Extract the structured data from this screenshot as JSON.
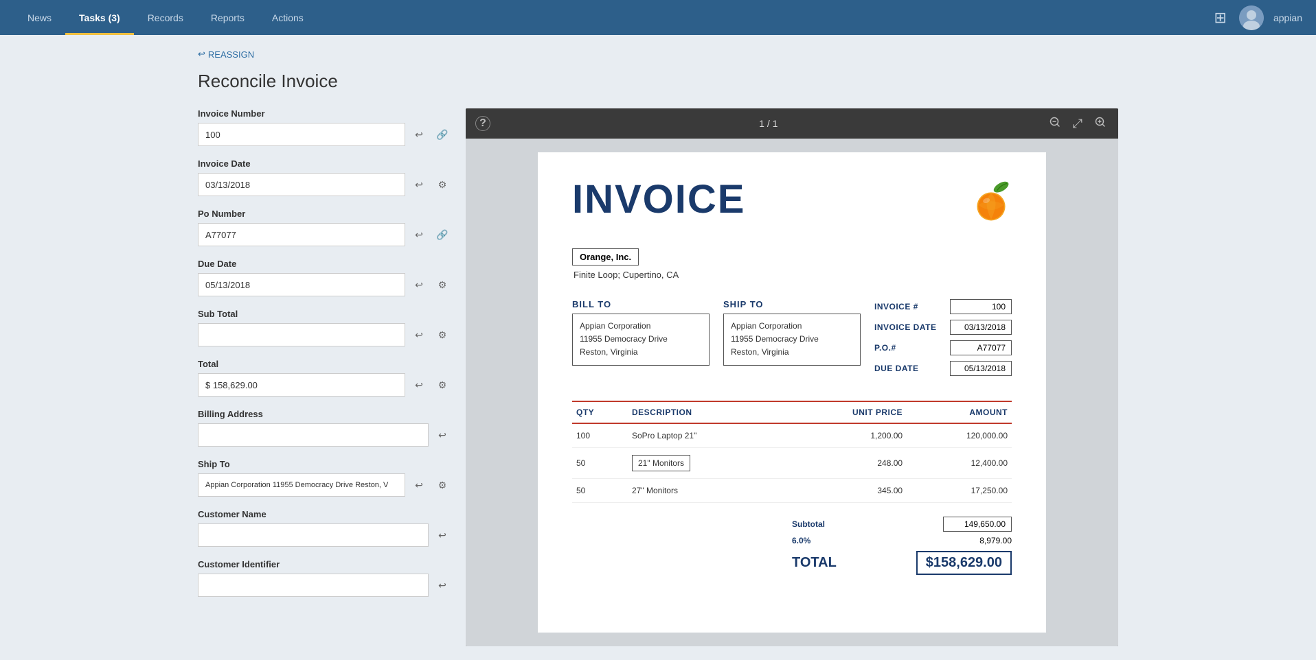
{
  "nav": {
    "items": [
      {
        "label": "News",
        "active": false
      },
      {
        "label": "Tasks (3)",
        "active": true
      },
      {
        "label": "Records",
        "active": false
      },
      {
        "label": "Reports",
        "active": false
      },
      {
        "label": "Actions",
        "active": false
      }
    ],
    "username": "appian",
    "grid_icon": "⊞"
  },
  "reassign": {
    "label": "REASSIGN",
    "icon": "↩"
  },
  "page": {
    "title": "Reconcile Invoice"
  },
  "form": {
    "fields": [
      {
        "id": "invoice-number",
        "label": "Invoice Number",
        "value": "100",
        "has_arrow": true,
        "has_link": true
      },
      {
        "id": "invoice-date",
        "label": "Invoice Date",
        "value": "03/13/2018",
        "has_arrow": true,
        "has_gear": true
      },
      {
        "id": "po-number",
        "label": "Po Number",
        "value": "A77077",
        "has_arrow": true,
        "has_link": true
      },
      {
        "id": "due-date",
        "label": "Due Date",
        "value": "05/13/2018",
        "has_arrow": true,
        "has_gear": true
      },
      {
        "id": "sub-total",
        "label": "Sub Total",
        "value": "",
        "has_arrow": true,
        "has_gear": true
      },
      {
        "id": "total",
        "label": "Total",
        "value": "$ 158,629.00",
        "has_arrow": true,
        "has_gear": true
      },
      {
        "id": "billing-address",
        "label": "Billing Address",
        "value": "",
        "has_arrow": true,
        "has_gear": false
      },
      {
        "id": "ship-to",
        "label": "Ship To",
        "value": "Appian Corporation 11955 Democracy Drive Reston, V",
        "has_arrow": true,
        "has_gear": true
      },
      {
        "id": "customer-name",
        "label": "Customer Name",
        "value": "",
        "has_arrow": true,
        "has_gear": false
      },
      {
        "id": "customer-identifier",
        "label": "Customer Identifier",
        "value": "",
        "has_arrow": true,
        "has_gear": false
      }
    ]
  },
  "pdf": {
    "page_indicator": "1 / 1",
    "toolbar": {
      "help_icon": "?",
      "zoom_out_icon": "🔍",
      "expand_icon": "⤢",
      "zoom_in_icon": "🔍"
    },
    "invoice": {
      "title": "INVOICE",
      "company": {
        "name": "Orange, Inc.",
        "address": "Finite Loop; Cupertino, CA"
      },
      "bill_to": {
        "label": "BILL TO",
        "line1": "Appian Corporation",
        "line2": "11955 Democracy Drive",
        "line3": "Reston, Virginia"
      },
      "ship_to": {
        "label": "SHIP TO",
        "line1": "Appian Corporation",
        "line2": "11955 Democracy Drive",
        "line3": "Reston, Virginia"
      },
      "meta": {
        "invoice_num_label": "INVOICE #",
        "invoice_num_value": "100",
        "invoice_date_label": "INVOICE DATE",
        "invoice_date_value": "03/13/2018",
        "po_label": "P.O.#",
        "po_value": "A77077",
        "due_date_label": "DUE DATE",
        "due_date_value": "05/13/2018"
      },
      "table": {
        "headers": [
          "QTY",
          "DESCRIPTION",
          "UNIT PRICE",
          "AMOUNT"
        ],
        "rows": [
          {
            "qty": "100",
            "description": "SoPro Laptop 21\"",
            "unit_price": "1,200.00",
            "amount": "120,000.00",
            "desc_boxed": false
          },
          {
            "qty": "50",
            "description": "21\" Monitors",
            "unit_price": "248.00",
            "amount": "12,400.00",
            "desc_boxed": true
          },
          {
            "qty": "50",
            "description": "27\" Monitors",
            "unit_price": "345.00",
            "amount": "17,250.00",
            "desc_boxed": false
          }
        ]
      },
      "totals": {
        "subtotal_label": "Subtotal",
        "subtotal_value": "149,650.00",
        "tax_label": "6.0%",
        "tax_value": "8,979.00",
        "grand_total_label": "TOTAL",
        "grand_total_value": "$158,629.00"
      }
    }
  }
}
